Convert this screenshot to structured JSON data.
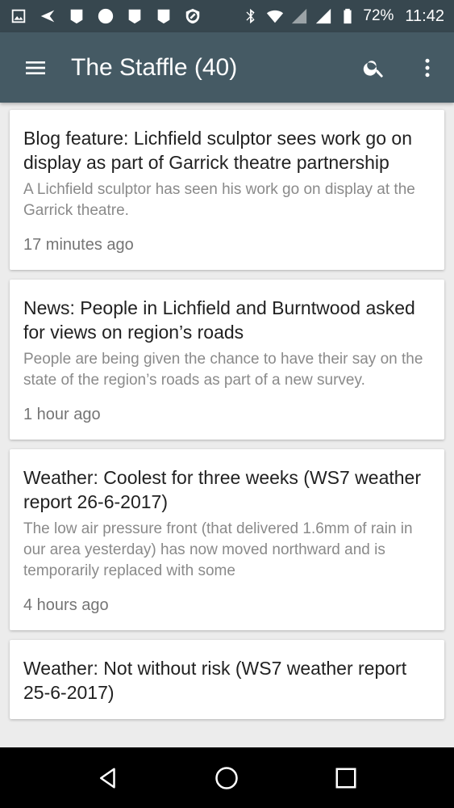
{
  "status_bar": {
    "battery_pct": "72%",
    "time": "11:42",
    "icons": [
      "image-icon",
      "send-icon",
      "notification-icon",
      "circle-icon",
      "notification-icon",
      "notification-icon",
      "blocked-icon",
      "bluetooth-icon",
      "wifi-icon",
      "signal-icon",
      "signal-icon",
      "battery-icon"
    ]
  },
  "app_bar": {
    "title": "The Staffle (40)",
    "background": "#455a64",
    "status_background": "#37474f"
  },
  "articles": [
    {
      "title": "Blog feature: Lichfield sculptor sees work go on display as part of Garrick theatre partnership",
      "description": "A Lichfield sculptor has seen his work go on display at the Garrick theatre.",
      "time": "17 minutes ago"
    },
    {
      "title": "News: People in Lichfield and Burntwood asked for views on region’s roads",
      "description": "People are being given the chance to have their say on the state of the region’s roads as part of a new survey.",
      "time": "1 hour ago"
    },
    {
      "title": "Weather: Coolest for three weeks (WS7 weather report 26-6-2017)",
      "description": "The low air pressure front (that delivered 1.6mm of rain in our area yesterday) has now moved northward and is temporarily replaced with some",
      "time": "4 hours ago"
    },
    {
      "title": "Weather: Not without risk (WS7 weather report 25-6-2017)",
      "description": "",
      "time": ""
    }
  ]
}
